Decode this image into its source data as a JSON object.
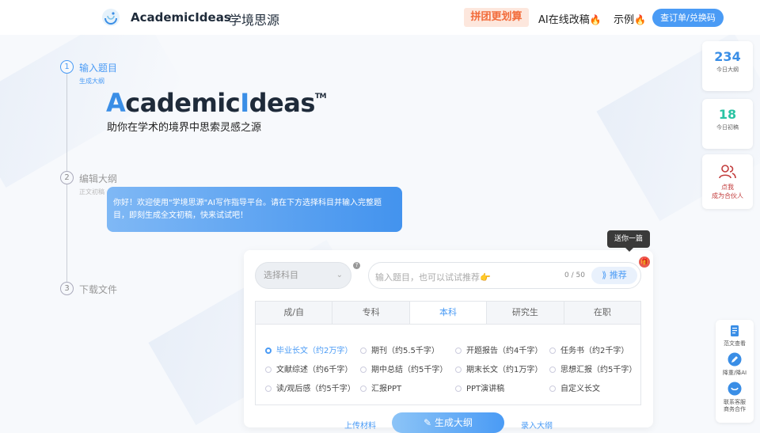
{
  "header": {
    "brand": "AcademicIdeas",
    "brand_cn": "学境思源",
    "nav_group": "拼团更划算",
    "nav_ai": "AI在线改稿",
    "nav_example": "示例",
    "order_button": "查订单/兑换码"
  },
  "steps": [
    {
      "num": "1",
      "title": "输入题目",
      "sub": "生成大纲"
    },
    {
      "num": "2",
      "title": "编辑大纲",
      "sub": "正文初稿"
    },
    {
      "num": "3",
      "title": "下载文件"
    }
  ],
  "hero": {
    "title_a": "A",
    "title_b": "cademic",
    "title_c": "I",
    "title_d": "deas",
    "tm": "TM",
    "subtitle": "助你在学术的境界中思索灵感之源",
    "bubble": "你好！欢迎使用\"学境思源\"AI写作指导平台。请在下方选择科目并输入完整题目，即刻生成全文初稿，快来试试吧！"
  },
  "sidebar": {
    "stat1": {
      "num": "234",
      "label": "今日大纲",
      "color": "#3a8ee6"
    },
    "stat2": {
      "num": "18",
      "label": "今日初稿",
      "color": "#2bc3a3"
    },
    "partner_line1": "点我",
    "partner_line2": "成为合伙人",
    "tools": [
      {
        "label": "范文查看"
      },
      {
        "label": "降重/降AI"
      },
      {
        "label_line1": "联系客服",
        "label_line2": "商务合作"
      }
    ]
  },
  "gift_tooltip": "送你一篇",
  "form": {
    "select_placeholder": "选择科目",
    "search_placeholder": "输入题目，也可以试试推荐👉",
    "count": "0 / 50",
    "recommend": "推荐",
    "tabs": [
      "成/自",
      "专科",
      "本科",
      "研究生",
      "在职"
    ],
    "options": [
      "毕业长文（约2万字）",
      "期刊（约5.5千字）",
      "开题报告（约4千字）",
      "任务书（约2千字）",
      "文献综述（约6千字）",
      "期中总结（约5千字）",
      "期末长文（约1万字）",
      "思想汇报（约5千字）",
      "读/观后感（约5千字）",
      "汇报PPT",
      "PPT演讲稿",
      "自定义长文"
    ],
    "upload": "上传材料",
    "generate": "生成大纲",
    "input_outline": "录入大纲"
  }
}
